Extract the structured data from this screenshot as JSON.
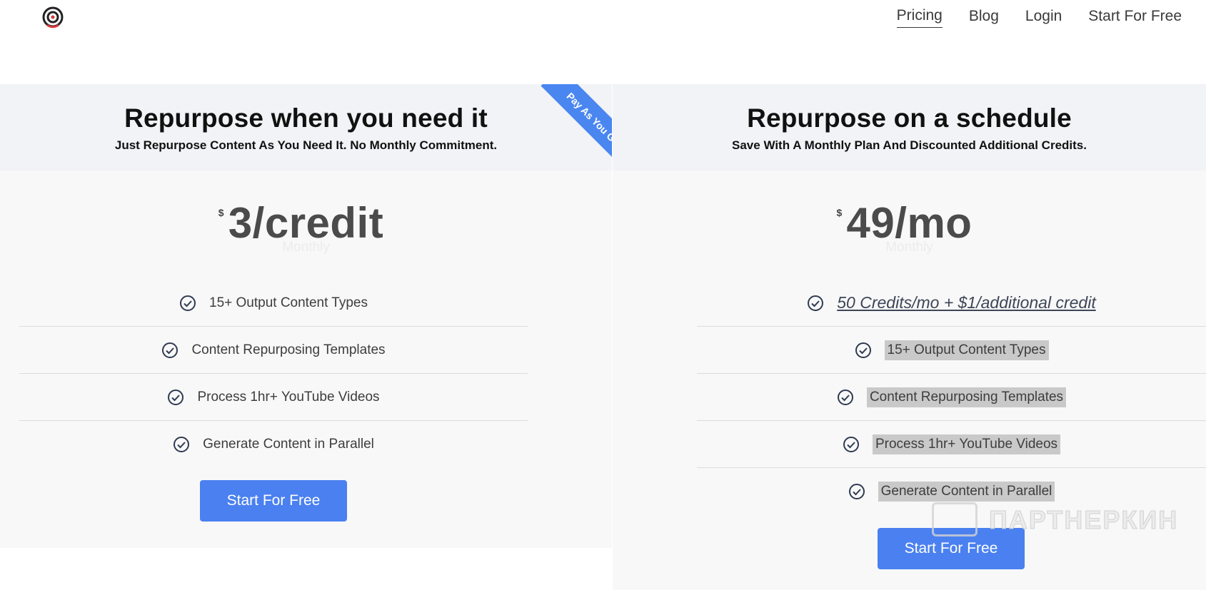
{
  "header": {
    "nav": [
      {
        "label": "Pricing",
        "active": true
      },
      {
        "label": "Blog"
      },
      {
        "label": "Login"
      },
      {
        "label": "Start For Free"
      }
    ]
  },
  "plans": [
    {
      "title": "Repurpose when you need it",
      "subtitle": "Just Repurpose Content As You Need It. No Monthly Commitment.",
      "ribbon": "Pay As You Go",
      "currency": "$",
      "price": "3/credit",
      "period": "Monthly",
      "features": [
        "15+ Output Content Types",
        "Content Repurposing Templates",
        "Process 1hr+ YouTube Videos",
        "Generate Content in Parallel"
      ],
      "cta": "Start For Free"
    },
    {
      "title": "Repurpose on a schedule",
      "subtitle": "Save With A Monthly Plan And Discounted Additional Credits.",
      "currency": "$",
      "price": "49/mo",
      "period": "Monthly",
      "features": [
        "50 Credits/mo + $1/additional credit",
        "15+ Output Content Types",
        "Content Repurposing Templates",
        "Process 1hr+ YouTube Videos",
        "Generate Content in Parallel"
      ],
      "cta": "Start For Free"
    }
  ],
  "watermark": "ПАРТНЕРКИН",
  "colors": {
    "accent": "#4a80f0",
    "ribbon": "#4a86f0",
    "header_band": "#f2f3f6",
    "card_bg": "#f8f8f8"
  }
}
